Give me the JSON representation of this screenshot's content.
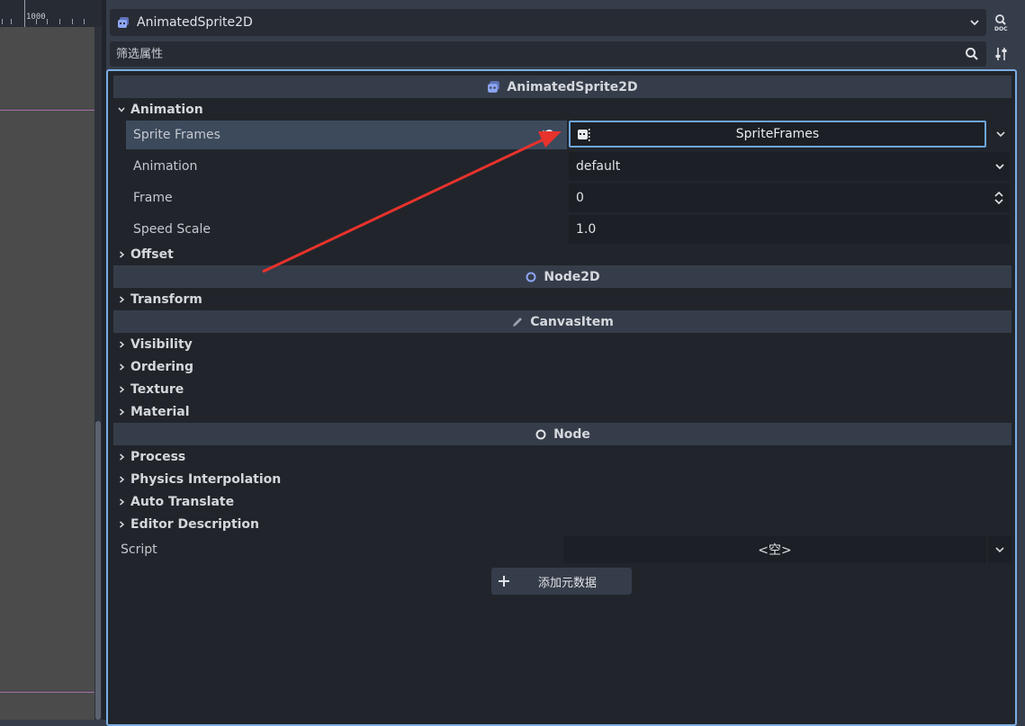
{
  "viewport": {
    "ruler_label": "1000"
  },
  "inspector": {
    "node_select_label": "AnimatedSprite2D",
    "filter_placeholder": "筛选属性",
    "doc_icon": "doc-icon",
    "tools_icon": "tools-icon"
  },
  "sections": {
    "animated_sprite": "AnimatedSprite2D",
    "node2d": "Node2D",
    "canvas_item": "CanvasItem",
    "node": "Node"
  },
  "groups": {
    "animation": "Animation",
    "offset": "Offset",
    "transform": "Transform",
    "visibility": "Visibility",
    "ordering": "Ordering",
    "texture": "Texture",
    "material": "Material",
    "process": "Process",
    "physics_interpolation": "Physics Interpolation",
    "auto_translate": "Auto Translate",
    "editor_description": "Editor Description"
  },
  "properties": {
    "sprite_frames": {
      "label": "Sprite Frames",
      "value": "SpriteFrames"
    },
    "animation": {
      "label": "Animation",
      "value": "default"
    },
    "frame": {
      "label": "Frame",
      "value": "0"
    },
    "speed_scale": {
      "label": "Speed Scale",
      "value": "1.0"
    }
  },
  "script": {
    "label": "Script",
    "value": "<空>"
  },
  "add_metadata_label": "添加元数据",
  "colors": {
    "accent": "#7aaee3",
    "arrow": "#e8322c",
    "node_icon": "#8da5f3"
  }
}
